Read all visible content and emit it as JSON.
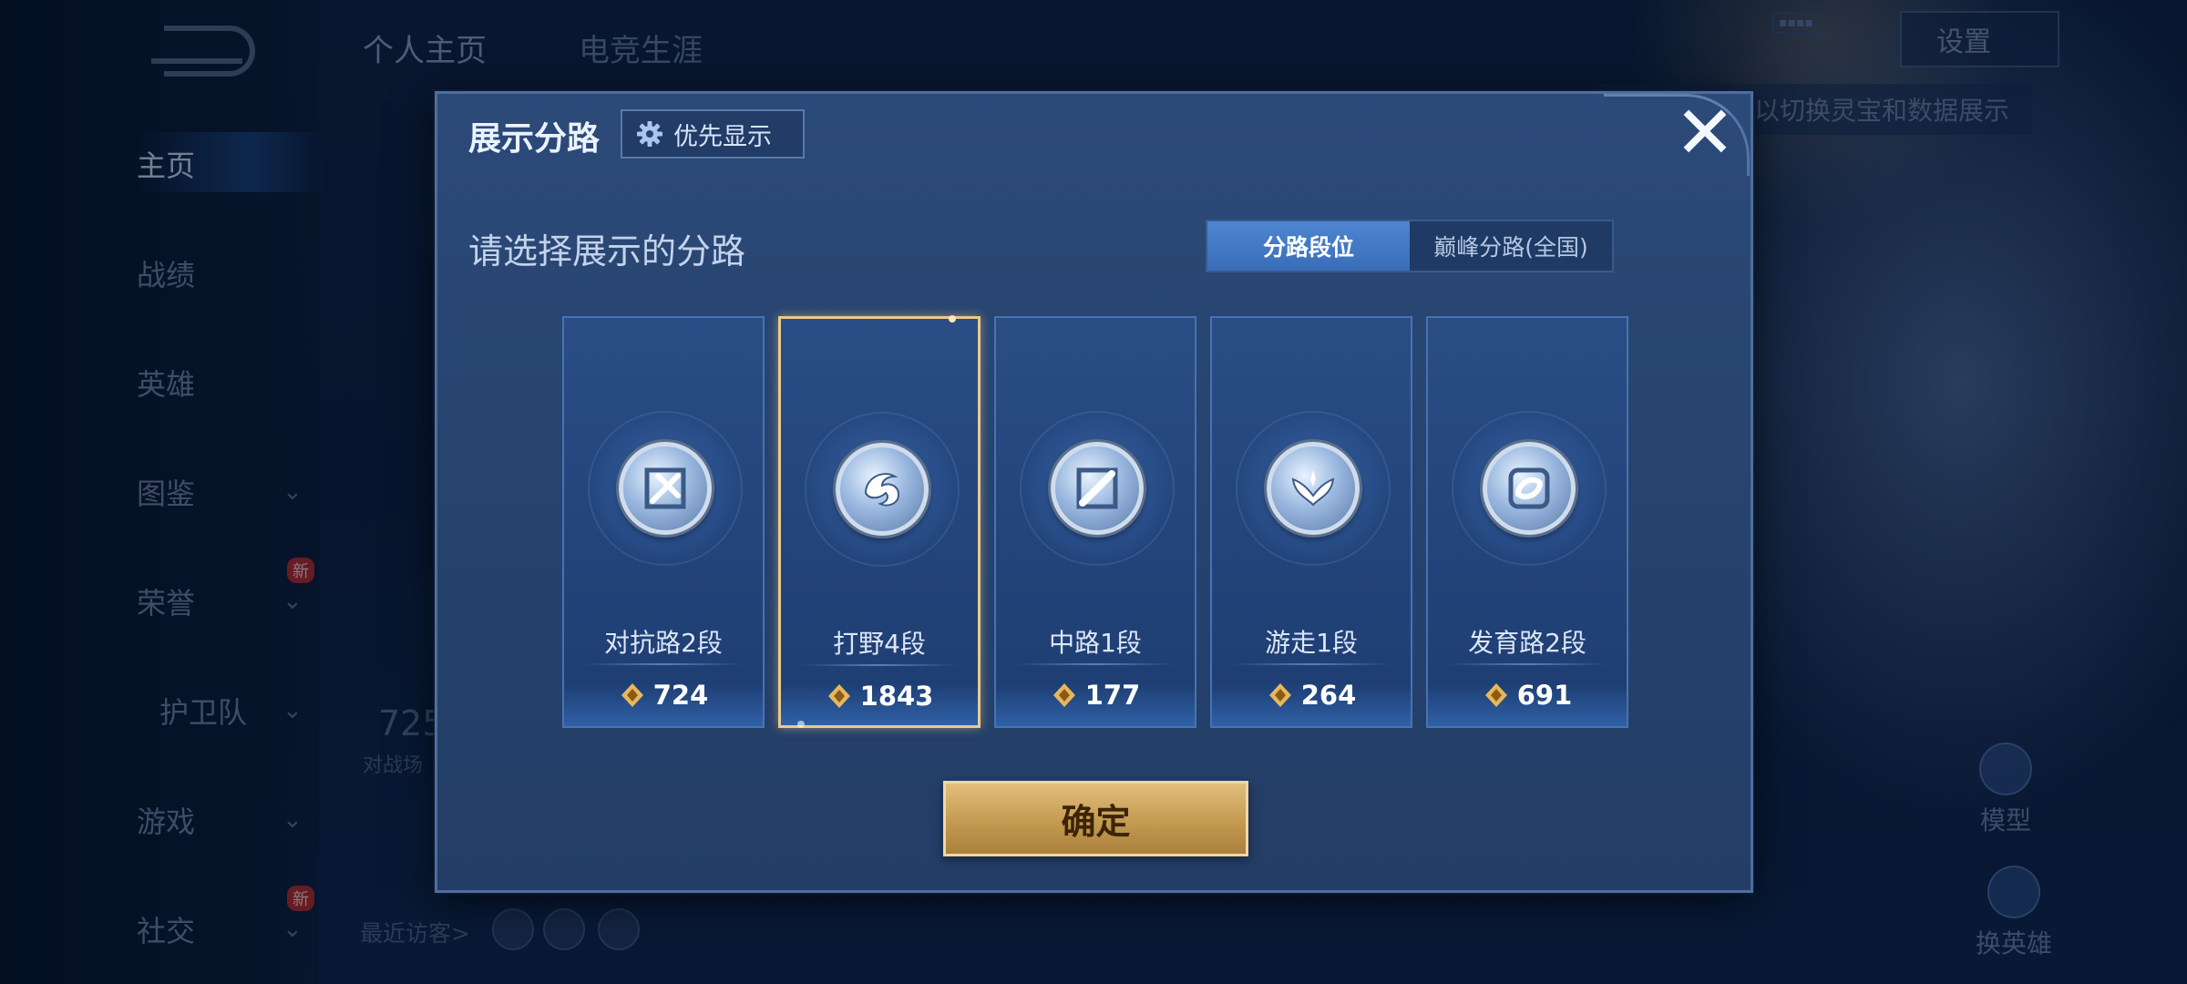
{
  "background": {
    "top_tabs": [
      "个人主页",
      "电竞生涯"
    ],
    "nav_items": [
      {
        "label": "主页",
        "has_chevron": false,
        "badge": ""
      },
      {
        "label": "战绩",
        "has_chevron": false,
        "badge": ""
      },
      {
        "label": "英雄",
        "has_chevron": false,
        "badge": ""
      },
      {
        "label": "图鉴",
        "has_chevron": true,
        "badge": ""
      },
      {
        "label": "荣誉",
        "has_chevron": true,
        "badge": "新"
      },
      {
        "label": "护卫队",
        "has_chevron": true,
        "badge": ""
      },
      {
        "label": "游戏",
        "has_chevron": true,
        "badge": ""
      },
      {
        "label": "社交",
        "has_chevron": true,
        "badge": "新"
      }
    ],
    "settings_label": "设置",
    "hint_text": "以切换灵宝和数据展示",
    "stat_value": "725",
    "stat_caption": "对战场",
    "recent_visitors_label": "最近访客>",
    "model_label": "模型",
    "switch_hero_label": "换英雄",
    "icons": [
      "back-arrow-icon",
      "chevron-down-icon"
    ]
  },
  "modal": {
    "title": "展示分路",
    "priority_label": "优先显示",
    "close_glyph": "✕",
    "subtitle": "请选择展示的分路",
    "segments": [
      {
        "label": "分路段位",
        "selected": true
      },
      {
        "label": "巅峰分路(全国)",
        "selected": false
      }
    ],
    "lanes": [
      {
        "name": "对抗路2段",
        "score": "724",
        "icon": "clash-lane-icon",
        "selected": false
      },
      {
        "name": "打野4段",
        "score": "1843",
        "icon": "jungle-icon",
        "selected": true
      },
      {
        "name": "中路1段",
        "score": "177",
        "icon": "mid-lane-icon",
        "selected": false
      },
      {
        "name": "游走1段",
        "score": "264",
        "icon": "roam-icon",
        "selected": false
      },
      {
        "name": "发育路2段",
        "score": "691",
        "icon": "farm-lane-icon",
        "selected": false
      }
    ],
    "confirm_label": "确定",
    "colors": {
      "panel": "#27446f",
      "accent_blue": "#3a6db8",
      "selected_border": "#e9c98d",
      "confirm_gold": "#c49a52",
      "score_icon_gold": "#e7b75a"
    }
  }
}
